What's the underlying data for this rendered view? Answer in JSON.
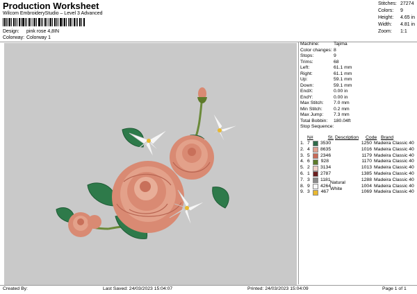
{
  "header": {
    "title": "Production Worksheet",
    "software": "Wilcom EmbroideryStudio – Level 3 Advanced",
    "design_label": "Design:",
    "design_value": "pink rose 4,8IN",
    "colorway_label": "Colorway:",
    "colorway_value": "Colorway 1"
  },
  "stats": [
    {
      "label": "Stitches:",
      "value": "27274"
    },
    {
      "label": "Colors:",
      "value": "9"
    },
    {
      "label": "Height:",
      "value": "4.65 in"
    },
    {
      "label": "Width:",
      "value": "4.81 in"
    },
    {
      "label": "Zoom:",
      "value": "1:1"
    }
  ],
  "info": [
    {
      "label": "Machine:",
      "value": "Tajima"
    },
    {
      "label": "Color changes:",
      "value": "8"
    },
    {
      "label": "Stops:",
      "value": "9"
    },
    {
      "label": "Trims:",
      "value": "68"
    },
    {
      "label": "Left:",
      "value": "61.1 mm"
    },
    {
      "label": "Right:",
      "value": "61.1 mm"
    },
    {
      "label": "Up:",
      "value": "59.1 mm"
    },
    {
      "label": "Down:",
      "value": "59.1 mm"
    },
    {
      "label": "EndX:",
      "value": "0.00 in"
    },
    {
      "label": "EndY:",
      "value": "0.00 in"
    },
    {
      "label": "Max Stitch:",
      "value": "7.0 mm"
    },
    {
      "label": "Min Stitch:",
      "value": "0.2 mm"
    },
    {
      "label": "Max Jump:",
      "value": "7.3 mm"
    },
    {
      "label": "Total Bobbin:",
      "value": "180.04ft"
    }
  ],
  "stop_sequence_title": "Stop Sequence:",
  "stop_columns": {
    "n": "N#",
    "st": "St.",
    "desc": "Description",
    "code": "Code",
    "brand": "Brand"
  },
  "stops": [
    {
      "stop": "1.",
      "n": "7",
      "color": "#2e6b4a",
      "st": "3530",
      "desc": "",
      "code": "1250",
      "brand": "Madeira Classic 40"
    },
    {
      "stop": "2.",
      "n": "4",
      "color": "#e0a090",
      "st": "8635",
      "desc": "",
      "code": "1016",
      "brand": "Madeira Classic 40"
    },
    {
      "stop": "3.",
      "n": "5",
      "color": "#c86a58",
      "st": "2346",
      "desc": "",
      "code": "1179",
      "brand": "Madeira Classic 40"
    },
    {
      "stop": "4.",
      "n": "6",
      "color": "#5d7a2a",
      "st": "928",
      "desc": "",
      "code": "1170",
      "brand": "Madeira Classic 40"
    },
    {
      "stop": "5.",
      "n": "2",
      "color": "#f0d0c8",
      "st": "3134",
      "desc": "",
      "code": "1013",
      "brand": "Madeira Classic 40"
    },
    {
      "stop": "6.",
      "n": "1",
      "color": "#6a1e1e",
      "st": "2787",
      "desc": "",
      "code": "1385",
      "brand": "Madeira Classic 40"
    },
    {
      "stop": "7.",
      "n": "3",
      "color": "#8a8a8a",
      "st": "1181",
      "desc": "",
      "code": "1288",
      "brand": "Madeira Classic 40"
    },
    {
      "stop": "8.",
      "n": "9",
      "color": "#f6f6f6",
      "st": "4264",
      "desc": "Natural White",
      "code": "1004",
      "brand": "Madeira Classic 40"
    },
    {
      "stop": "9.",
      "n": "3",
      "color": "#e8b830",
      "st": "467",
      "desc": "",
      "code": "1069",
      "brand": "Madeira Classic 40"
    }
  ],
  "footer": {
    "created_by": "Created By:",
    "last_saved": "Last Saved: 24/03/2023 15:04:07",
    "printed": "Printed: 24/03/2023 15:04:09",
    "page": "Page 1 of 1"
  }
}
